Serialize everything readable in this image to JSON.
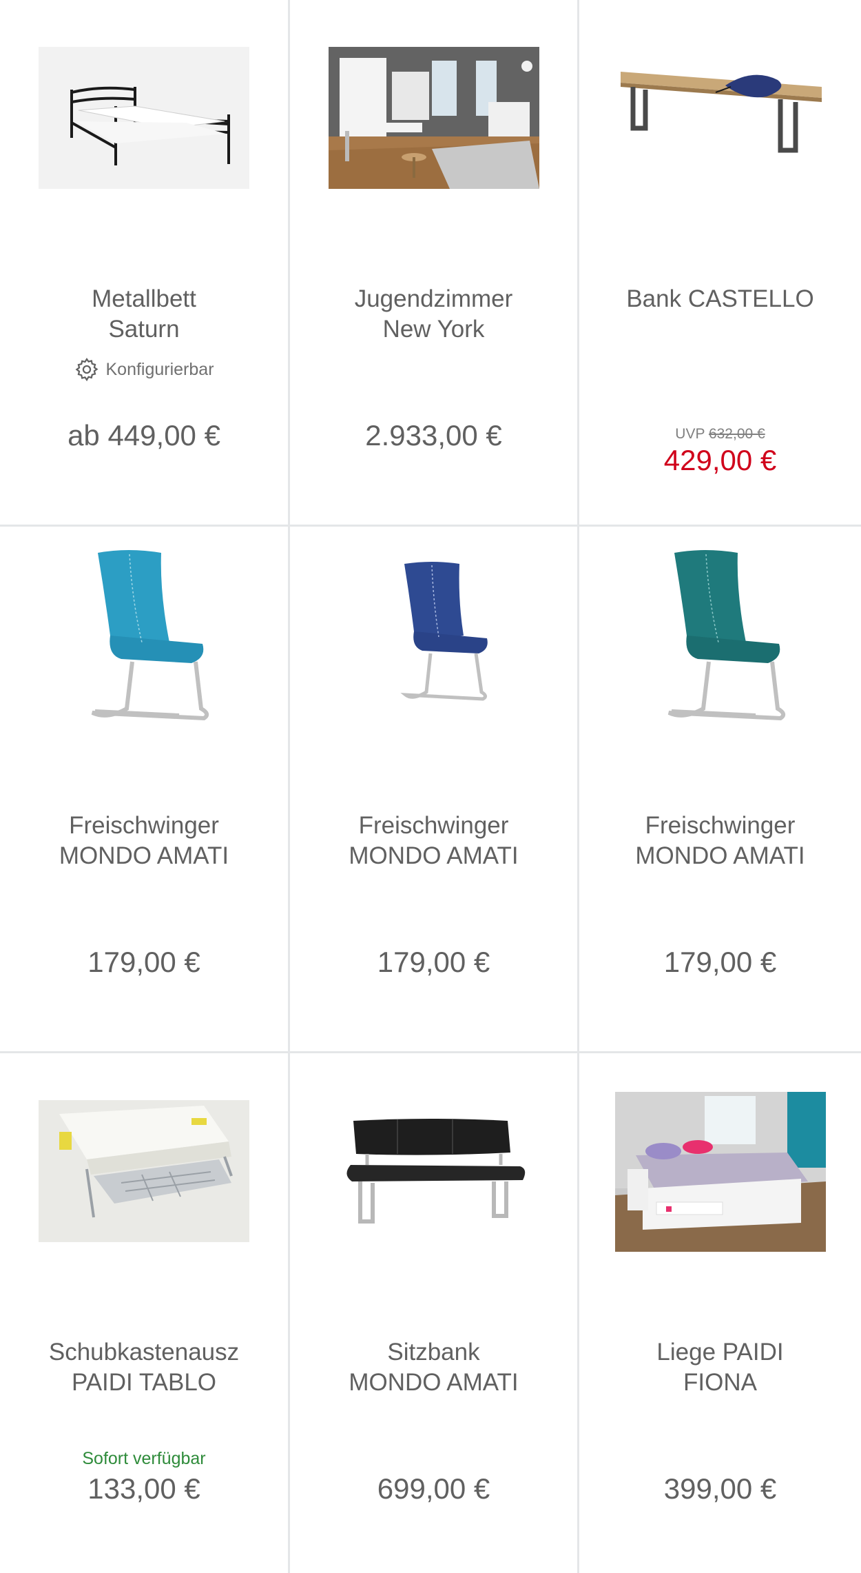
{
  "products": [
    {
      "name_line1": "Metallbett",
      "name_line2": "Saturn",
      "badge": "Konfigurierbar",
      "price": "ab 449,00 €",
      "image_icon": "metal-bed-image"
    },
    {
      "name_line1": "Jugendzimmer",
      "name_line2": "New York",
      "price": "2.933,00 €",
      "image_icon": "youth-room-image"
    },
    {
      "name_line1": "Bank CASTELLO",
      "name_line2": "",
      "uvp_label": "UVP",
      "uvp_old_price": "632,00 €",
      "sale_price": "429,00 €",
      "image_icon": "bench-image"
    },
    {
      "name_line1": "Freischwinger",
      "name_line2": "MONDO AMATI",
      "price": "179,00 €",
      "image_icon": "turquoise-chair-image"
    },
    {
      "name_line1": "Freischwinger",
      "name_line2": "MONDO AMATI",
      "price": "179,00 €",
      "image_icon": "blue-chair-image"
    },
    {
      "name_line1": "Freischwinger",
      "name_line2": "MONDO AMATI",
      "price": "179,00 €",
      "image_icon": "teal-chair-image"
    },
    {
      "name_line1": "Schubkastenausz",
      "name_line2": "PAIDI TABLO",
      "availability": "Sofort verfügbar",
      "price": "133,00 €",
      "image_icon": "drawer-image"
    },
    {
      "name_line1": "Sitzbank",
      "name_line2": "MONDO AMATI",
      "price": "699,00 €",
      "image_icon": "seat-bench-image"
    },
    {
      "name_line1": "Liege PAIDI",
      "name_line2": "FIONA",
      "price": "399,00 €",
      "image_icon": "daybed-image"
    }
  ],
  "colors": {
    "text": "#606060",
    "sale": "#d0021b",
    "available": "#2e8b3a",
    "divider": "#e4e6e8"
  }
}
